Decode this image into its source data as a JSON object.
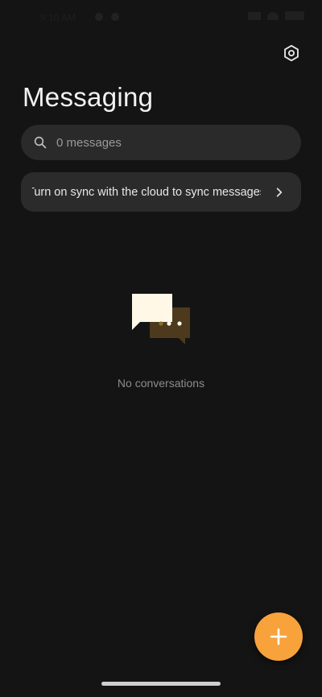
{
  "status_bar": {
    "time": "9:10 AM"
  },
  "header": {
    "title": "Messaging",
    "settings_icon": "settings-hexagon-icon"
  },
  "search": {
    "placeholder": "0 messages",
    "icon": "search-icon"
  },
  "sync_banner": {
    "text": "Turn on sync with the cloud to sync messages",
    "icon": "chevron-right-icon"
  },
  "empty_state": {
    "icon": "chat-bubbles-icon",
    "text": "No conversations"
  },
  "fab": {
    "icon": "plus-icon",
    "color": "#f7a23b"
  },
  "colors": {
    "background": "#141414",
    "surface": "#2a2a2a",
    "accent": "#f7a23b"
  }
}
